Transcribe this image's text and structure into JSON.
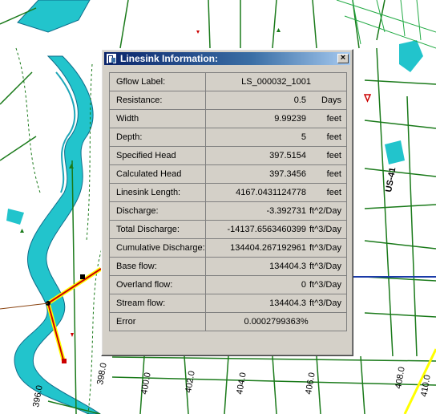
{
  "dialog": {
    "title": "Linesink Information:",
    "close_label": "×",
    "rows": [
      {
        "label": "Gflow Label:",
        "value": "LS_000032_1001",
        "unit": ""
      },
      {
        "label": "Resistance:",
        "value": "0.5",
        "unit": "Days"
      },
      {
        "label": "Width",
        "value": "9.99239",
        "unit": "feet"
      },
      {
        "label": "Depth:",
        "value": "5",
        "unit": "feet"
      },
      {
        "label": "Specified Head",
        "value": "397.5154",
        "unit": "feet"
      },
      {
        "label": "Calculated Head",
        "value": "397.3456",
        "unit": "feet"
      },
      {
        "label": "Linesink Length:",
        "value": "4167.0431124778",
        "unit": "feet"
      },
      {
        "label": "Discharge:",
        "value": "-3.392731",
        "unit": "ft^2/Day"
      },
      {
        "label": "Total Discharge:",
        "value": "-14137.6563460399",
        "unit": "ft^3/Day"
      },
      {
        "label": "Cumulative Discharge:",
        "value": "134404.267192961",
        "unit": "ft^3/Day"
      },
      {
        "label": "Base flow:",
        "value": "134404.3",
        "unit": "ft^3/Day"
      },
      {
        "label": "Overland flow:",
        "value": "0",
        "unit": "ft^3/Day"
      },
      {
        "label": "Stream flow:",
        "value": "134404.3",
        "unit": "ft^3/Day"
      },
      {
        "label": "Error",
        "value": "0.0002799363%",
        "unit": ""
      }
    ]
  },
  "map": {
    "contour_labels": [
      "396.0",
      "398.0",
      "400.0",
      "402.0",
      "404.0",
      "406.0",
      "408.0",
      "410.0"
    ],
    "highway_label": "US-41",
    "colors": {
      "river": "#22c4cc",
      "linesink": "#cc0000",
      "road": "#1a7a1a",
      "highlight": "#ffff00"
    }
  }
}
